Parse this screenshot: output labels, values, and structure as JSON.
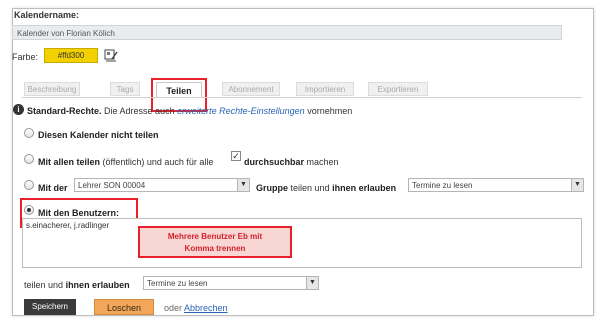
{
  "calendar_name": {
    "label": "Kalendername:",
    "value": "Kalender von Florian Kölich"
  },
  "color": {
    "label": "Farbe:",
    "value": "#ffd300",
    "swatch_color": "#f3d000",
    "icon": "palette-icon"
  },
  "tabs": [
    {
      "label": "Beschreibung"
    },
    {
      "label": "Tags"
    },
    {
      "label": "Teilen",
      "active": true
    },
    {
      "label": "Abonnement"
    },
    {
      "label": "Importieren"
    },
    {
      "label": "Exportieren"
    }
  ],
  "info": {
    "bold": "Standard-Rechte.",
    "text": "Die Adresse auch",
    "link": "erweiterte Rechte-Einstellungen",
    "suffix": "vornehmen"
  },
  "options": {
    "no_share": "Diesen Kalender nicht teilen",
    "share_all": {
      "bold1": "Mit allen teilen",
      "text1": "(öffentlich) und auch für alle",
      "bold2": "durchsuchbar",
      "text2": "machen"
    },
    "share_group": {
      "bold1": "Mit der",
      "group_value": "Lehrer SON 00004",
      "bold2": "Gruppe",
      "text1": "teilen und",
      "bold3": "ihnen erlauben",
      "permission_value": "Termine zu lesen"
    },
    "share_users": {
      "label": "Mit den Benutzern:",
      "value": "s.einacherer, j.radlinger"
    }
  },
  "annotation": {
    "line1": "Mehrere Benutzer Eb mit",
    "line2": "Komma trennen"
  },
  "bottom_permission": {
    "text1": "teilen und",
    "bold": "ihnen erlauben",
    "value": "Termine zu lesen"
  },
  "actions": {
    "save": "Speichern",
    "delete": "Loschen",
    "or": "oder",
    "cancel": "Abbrechen"
  },
  "colors": {
    "highlight": "#e8202a",
    "link": "#2a64b4",
    "annotation_fill": "#f7d6d4"
  }
}
